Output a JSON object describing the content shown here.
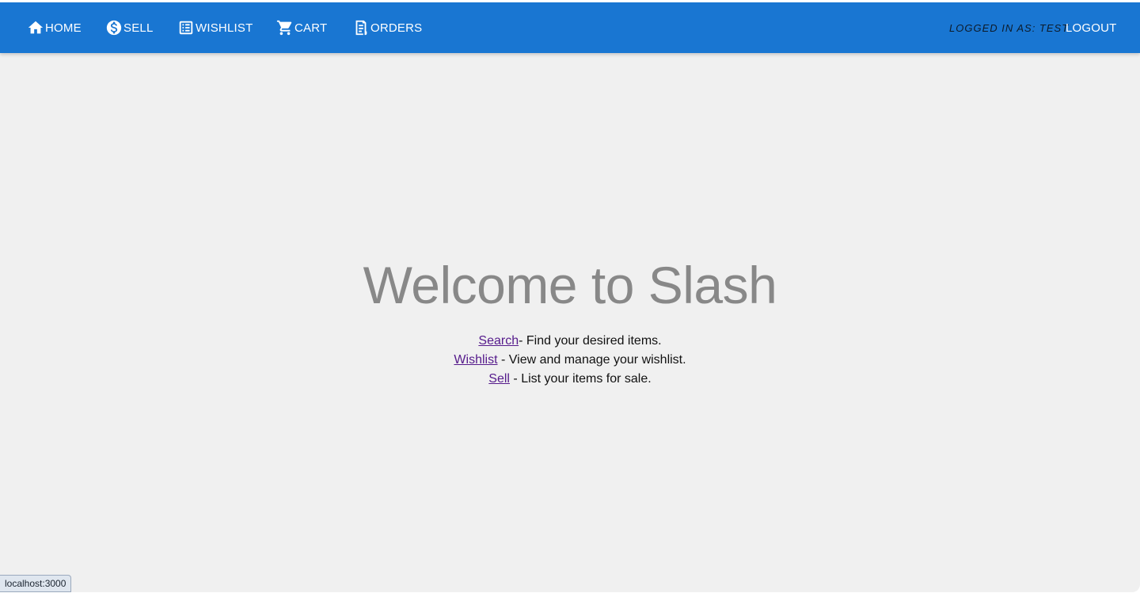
{
  "navbar": {
    "items": [
      {
        "label": "HOME",
        "icon": "home-icon"
      },
      {
        "label": "SELL",
        "icon": "dollar-circle-icon"
      },
      {
        "label": "WISHLIST",
        "icon": "list-icon"
      },
      {
        "label": "CART",
        "icon": "cart-icon"
      },
      {
        "label": "ORDERS",
        "icon": "receipt-icon"
      }
    ],
    "logged_in_text": "LOGGED IN AS: TEST",
    "logout_label": "LOGOUT",
    "background_color": "#1976d2"
  },
  "main": {
    "title": "Welcome to Slash",
    "features": [
      {
        "link": "Search",
        "description": "- Find your desired items."
      },
      {
        "link": "Wishlist",
        "description": " - View and manage your wishlist."
      },
      {
        "link": "Sell",
        "description": " - List your items for sale."
      }
    ]
  },
  "status_bar": {
    "url": "localhost:3000"
  }
}
